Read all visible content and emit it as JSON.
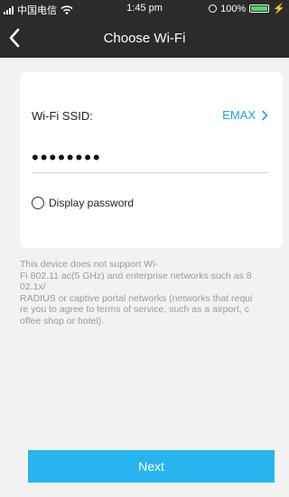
{
  "status_bar": {
    "carrier": "中国电信",
    "time": "1:45 pm",
    "battery": "100%"
  },
  "nav": {
    "title": "Choose Wi-Fi",
    "back_icon": "chevron-left-icon"
  },
  "form": {
    "ssid_label": "Wi-Fi SSID:",
    "ssid_value": "EMAX",
    "password_value": "••••••••",
    "display_password_label": "Display password",
    "display_password_checked": false
  },
  "notice": "This device does not support Wi-\nFi 802.11 ac(5 GHz) and enterprise networks such as 8\n02.1x/\nRADIUS or captive portal networks (networks that requi\nre you to agree to terms of service, such as a airport, c\noffee shop or hotel).",
  "footer": {
    "next_label": "Next"
  },
  "colors": {
    "header_bg": "#2b2b2b",
    "accent": "#1aa3e8",
    "button_bg": "#28b4ee",
    "battery": "#4cd964"
  }
}
